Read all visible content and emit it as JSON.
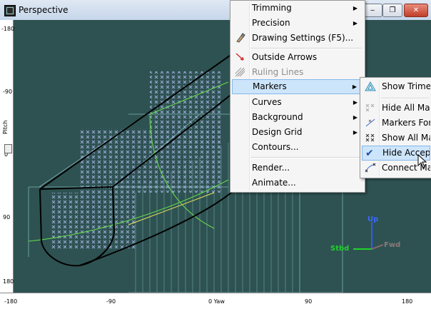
{
  "window": {
    "title": "Perspective",
    "minimize_glyph": "‒",
    "restore_glyph": "❐",
    "close_glyph": "✕"
  },
  "rulers": {
    "left_ticks": [
      "-180",
      "-90",
      "0",
      "90",
      "180"
    ],
    "left_label": "Pitch",
    "bottom_ticks": [
      "-180",
      "-90",
      "0 Yaw",
      "90",
      "180"
    ]
  },
  "axes": {
    "up": "Up",
    "stbd": "Stbd",
    "fwd": "Fwd"
  },
  "context_menu": {
    "items": [
      {
        "label": "Trimming",
        "submenu": true
      },
      {
        "label": "Precision",
        "submenu": true
      },
      {
        "label": "Drawing Settings (F5)...",
        "icon": "brush-icon"
      },
      {
        "label": "Outside Arrows",
        "icon": "arrow-icon"
      },
      {
        "label": "Ruling Lines",
        "icon": "ruling-lines-icon",
        "disabled": true
      },
      {
        "label": "Markers",
        "submenu": true,
        "highlighted": true
      },
      {
        "label": "Curves",
        "submenu": true
      },
      {
        "label": "Background",
        "submenu": true
      },
      {
        "label": "Design Grid",
        "submenu": true
      },
      {
        "label": "Contours..."
      },
      {
        "label": "Render..."
      },
      {
        "label": "Animate..."
      }
    ]
  },
  "markers_submenu": {
    "items": [
      {
        "label": "Show Trimes",
        "icon": "triangle-markers-icon"
      },
      {
        "label": "Hide All Mark",
        "icon": "hide-markers-icon"
      },
      {
        "label": "Markers For C",
        "icon": "markers-for-curve-icon"
      },
      {
        "label": "Show All Mar",
        "icon": "show-markers-icon"
      },
      {
        "label": "Hide Accepta",
        "icon": "checkmark-icon",
        "checked": true,
        "highlighted": true
      },
      {
        "label": "Connect Mar",
        "icon": "connect-markers-icon"
      }
    ]
  }
}
